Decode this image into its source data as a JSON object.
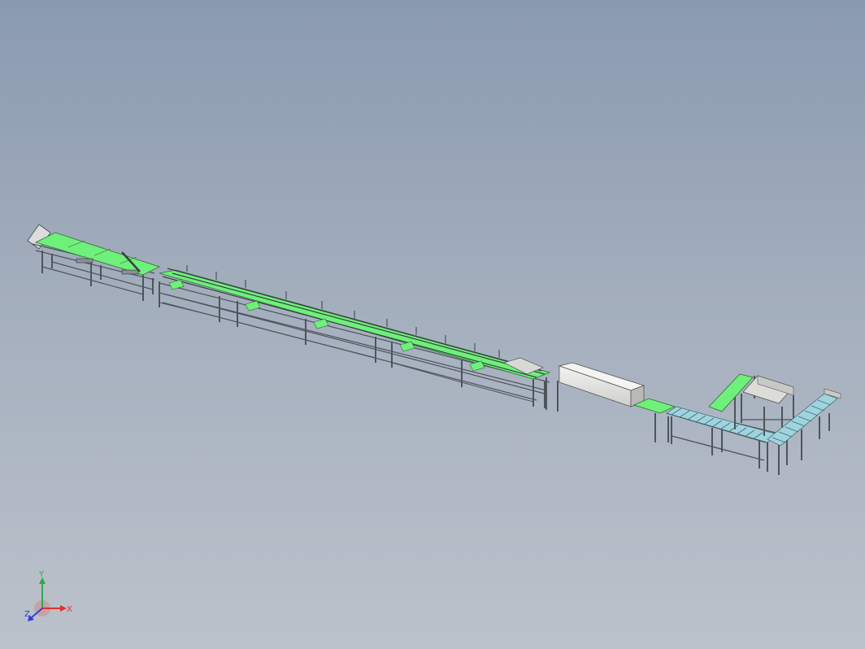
{
  "viewport": {
    "background_top": "#8a9ab0",
    "background_bottom": "#bcc2cb"
  },
  "model": {
    "belt_color": "#6ef07a",
    "frame_color": "#5a5f66",
    "roller_color": "#9fd3de",
    "housing_color": "#e8e8e6"
  },
  "triad": {
    "x_label": "X",
    "y_label": "Y",
    "z_label": "Z",
    "x_color": "#e03030",
    "y_color": "#2ea84a",
    "z_color": "#2f3fd8"
  }
}
